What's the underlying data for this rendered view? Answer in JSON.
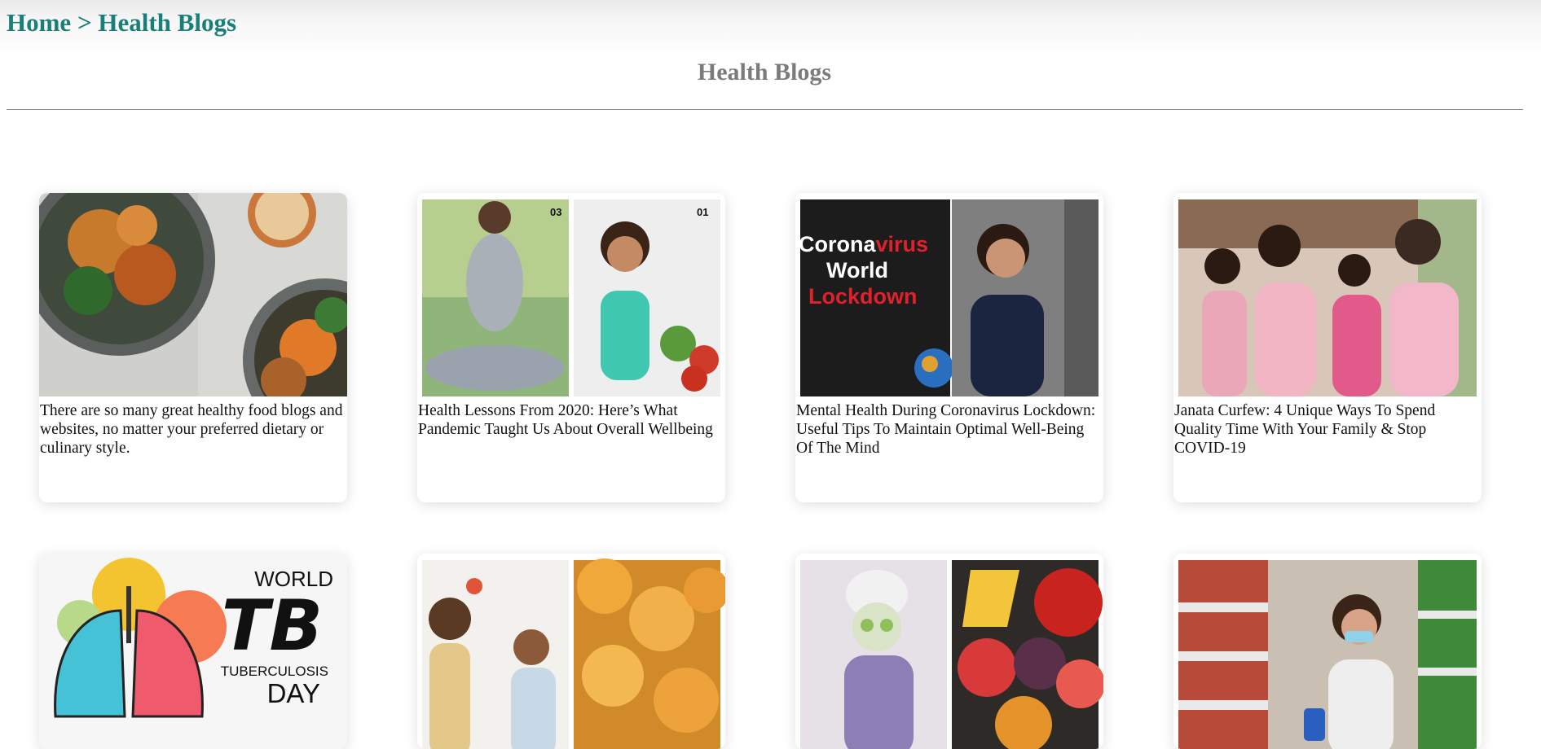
{
  "breadcrumb": {
    "home": "Home",
    "separator": ">",
    "current": "Health Blogs"
  },
  "page": {
    "title": "Health Blogs"
  },
  "cards": [
    {
      "caption": "There are so many great healthy food blogs and websites, no matter your preferred dietary or culinary style."
    },
    {
      "caption": "Health Lessons From 2020: Here’s What Pandemic Taught Us About Overall Wellbeing",
      "img_text": [
        "03",
        "01"
      ]
    },
    {
      "caption": "Mental Health During Coronavirus Lockdown: Useful Tips To Maintain Optimal Well-Being Of The Mind",
      "img_text": [
        "Corona",
        "virus",
        "World",
        "Lockdown"
      ]
    },
    {
      "caption": "Janata Curfew: 4 Unique Ways To Spend Quality Time With Your Family & Stop COVID-19"
    },
    {
      "caption": "",
      "img_text": [
        "WORLD",
        "TB",
        "TUBERCULOSIS",
        "DAY"
      ]
    },
    {
      "caption": ""
    },
    {
      "caption": ""
    },
    {
      "caption": ""
    }
  ],
  "colors": {
    "breadcrumb": "#1a7f7b",
    "title": "#7b7b7b",
    "corona_red": "#e0202a"
  }
}
